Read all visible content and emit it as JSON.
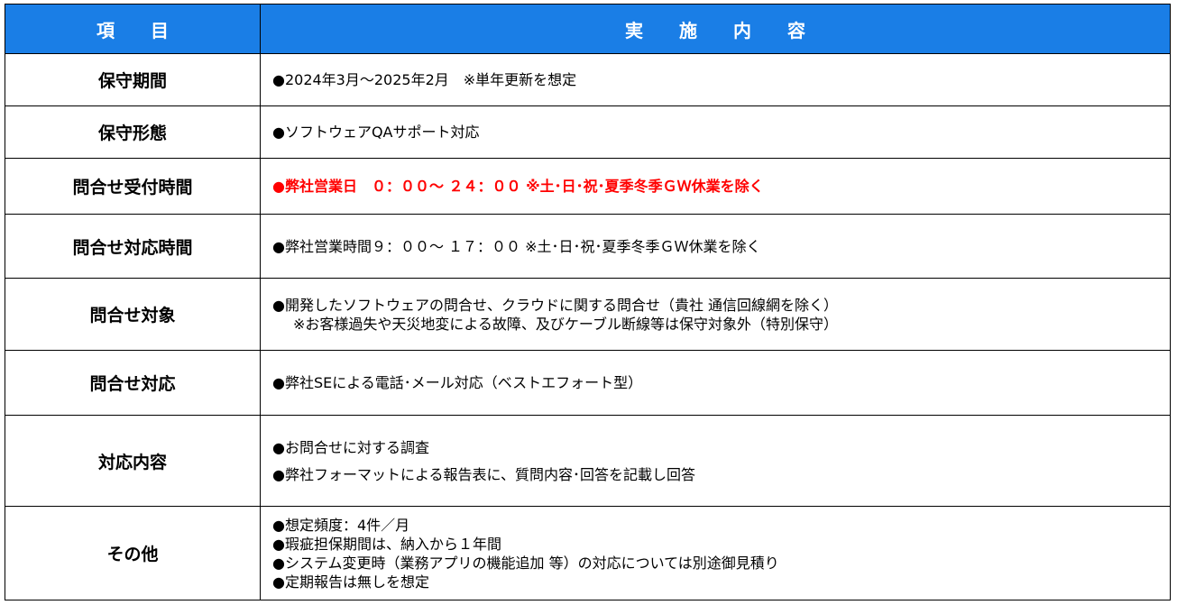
{
  "header": {
    "item": "項　　目",
    "content": "実　　施　　内　　容"
  },
  "rows": [
    {
      "label": "保守期間",
      "lines": [
        "●2024年3月～2025年2月　※単年更新を想定"
      ]
    },
    {
      "label": "保守形態",
      "lines": [
        "●ソフトウェアQAサポート対応"
      ]
    },
    {
      "label": "問合せ受付時間",
      "lines": [
        "●弊社営業日　０：００～ ２４：００ ※土･日･祝･夏季冬季ＧＷ休業を除く"
      ],
      "color": "#ff0000"
    },
    {
      "label": "問合せ対応時間",
      "lines": [
        "●弊社営業時間９：００～ １７：００ ※土･日･祝･夏季冬季ＧＷ休業を除く"
      ]
    },
    {
      "label": "問合せ対象",
      "lines": [
        "●開発したソフトウェアの問合せ、クラウドに関する問合せ（貴社 通信回線網を除く）",
        "※お客様過失や天災地変による故障、及びケーブル断線等は保守対象外（特別保守）"
      ]
    },
    {
      "label": "問合せ対応",
      "lines": [
        "●弊社SEによる電話･メール対応（ベストエフォート型）"
      ]
    },
    {
      "label": "対応内容",
      "lines": [
        "●お問合せに対する調査",
        "●弊社フォーマットによる報告表に、質問内容･回答を記載し回答"
      ]
    },
    {
      "label": "その他",
      "lines": [
        "●想定頻度：4件／月",
        "●瑕疵担保期間は、納入から１年間",
        "●システム変更時（業務アプリの機能追加 等）の対応については別途御見積り",
        "●定期報告は無しを想定"
      ]
    }
  ],
  "colors": {
    "header_bg": "#1a7ee6",
    "header_text": "#ffffff",
    "highlight": "#ff0000"
  }
}
